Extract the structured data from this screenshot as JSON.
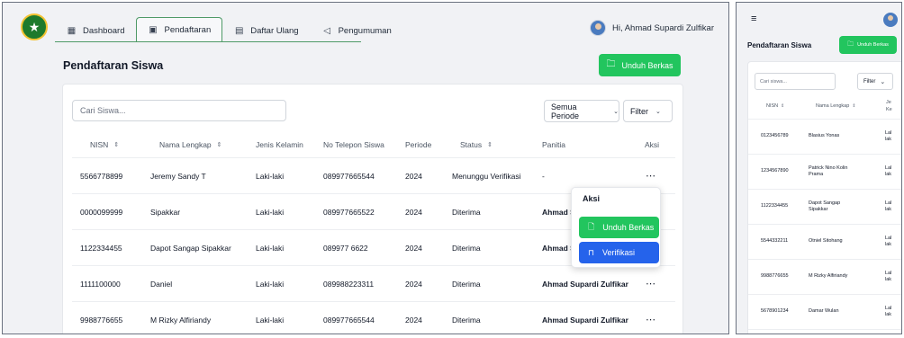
{
  "nav": {
    "items": [
      {
        "label": "Dashboard",
        "icon": "dashboard-icon"
      },
      {
        "label": "Pendaftaran",
        "icon": "form-icon"
      },
      {
        "label": "Daftar Ulang",
        "icon": "save-icon"
      },
      {
        "label": "Pengumuman",
        "icon": "megaphone-icon"
      }
    ],
    "active_index": 1
  },
  "user": {
    "greeting": "Hi, Ahmad Supardi Zulfikar"
  },
  "page": {
    "title": "Pendaftaran Siswa",
    "download_label": "Unduh Berkas"
  },
  "toolbar": {
    "search_placeholder": "Cari Siswa...",
    "periode_label": "Semua Periode",
    "filter_label": "Filter"
  },
  "table": {
    "headers": [
      "NISN",
      "Nama Lengkap",
      "Jenis Kelamin",
      "No Telepon Siswa",
      "Periode",
      "Status",
      "Panitia",
      "Aksi"
    ],
    "rows": [
      {
        "nisn": "5566778899",
        "nama": "Jeremy Sandy T",
        "jk": "Laki-laki",
        "tel": "089977665544",
        "periode": "2024",
        "status": "Menunggu Verifikasi",
        "panitia": "-"
      },
      {
        "nisn": "0000099999",
        "nama": "Sipakkar",
        "jk": "Laki-laki",
        "tel": "089977665522",
        "periode": "2024",
        "status": "Diterima",
        "panitia": "Ahmad Su"
      },
      {
        "nisn": "1122334455",
        "nama": "Dapot Sangap Sipakkar",
        "jk": "Laki-laki",
        "tel": "089977 6622",
        "periode": "2024",
        "status": "Diterima",
        "panitia": "Ahmad Su"
      },
      {
        "nisn": "1111100000",
        "nama": "Daniel",
        "jk": "Laki-laki",
        "tel": "089988223311",
        "periode": "2024",
        "status": "Diterima",
        "panitia": "Ahmad Supardi Zulfikar"
      },
      {
        "nisn": "9988776655",
        "nama": "M Rizky Alfiriandy",
        "jk": "Laki-laki",
        "tel": "089977665544",
        "periode": "2024",
        "status": "Diterima",
        "panitia": "Ahmad Supardi Zulfikar"
      }
    ],
    "action_glyph": "⋯"
  },
  "action_menu": {
    "title": "Aksi",
    "download_label": "Unduh Berkas",
    "verify_label": "Verifikasi"
  },
  "mobile": {
    "title": "Pendaftaran Siswa",
    "download_label": "Unduh Berkas",
    "search_placeholder": "Cari siswa...",
    "filter_label": "Filter",
    "headers": [
      "NISN",
      "Nama Lengkap",
      "Je Ke"
    ],
    "rows": [
      {
        "nisn": "0123456789",
        "nama": "Blasius Yonas",
        "jk": "Lal lak"
      },
      {
        "nisn": "1234567890",
        "nama": "Patrick Nino Kolin Prama",
        "jk": "Lal lak"
      },
      {
        "nisn": "1122334455",
        "nama": "Dapot Sangap Sipakkar",
        "jk": "Lal lak"
      },
      {
        "nisn": "5544332211",
        "nama": "Otniel Sitohang",
        "jk": "Lal lak"
      },
      {
        "nisn": "9988776655",
        "nama": "M Rizky Alfiriandy",
        "jk": "Lal lak"
      },
      {
        "nisn": "5678901234",
        "nama": "Damar Wulan",
        "jk": "Lal lak"
      }
    ]
  },
  "colors": {
    "primary_green": "#22c55e",
    "verify_blue": "#2563eb",
    "nav_border": "#4f9a67",
    "logo_green": "#1e7a2c"
  }
}
